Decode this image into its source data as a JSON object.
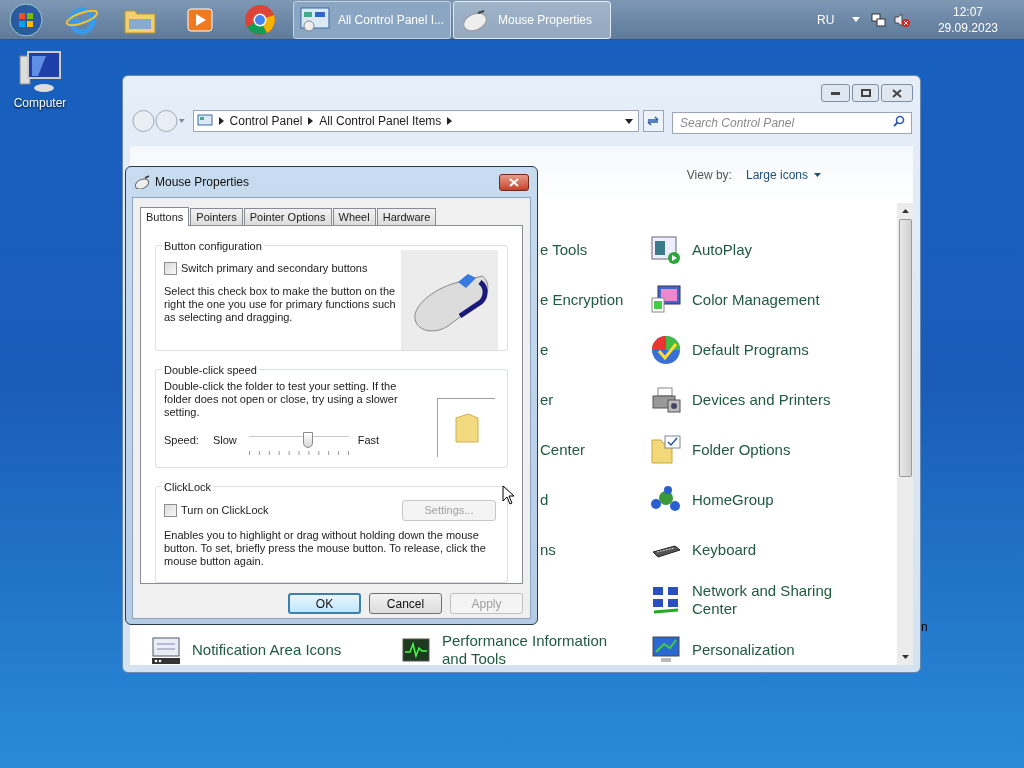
{
  "taskbar": {
    "tasks": [
      {
        "label": "All Control Panel I...",
        "selected": false
      },
      {
        "label": "Mouse Properties",
        "selected": true
      }
    ],
    "language": "RU",
    "time": "12:07",
    "date": "29.09.2023"
  },
  "desktop": {
    "icon_label": "Computer",
    "edge_text": "n"
  },
  "control_panel": {
    "breadcrumbs": [
      "Control Panel",
      "All Control Panel Items"
    ],
    "search": {
      "placeholder": "Search Control Panel"
    },
    "view_by_label": "View by:",
    "view_by_value": "Large icons",
    "rows": [
      {
        "middle": {
          "label": "e Tools",
          "kind": "fragment"
        },
        "right": {
          "label": "AutoPlay",
          "kind": "item"
        }
      },
      {
        "middle": {
          "label": "e Encryption",
          "kind": "fragment"
        },
        "right": {
          "label": "Color Management",
          "kind": "item"
        }
      },
      {
        "middle": {
          "label": "e",
          "kind": "fragment"
        },
        "right": {
          "label": "Default Programs",
          "kind": "item"
        }
      },
      {
        "middle": {
          "label": "er",
          "kind": "fragment"
        },
        "right": {
          "label": "Devices and Printers",
          "kind": "item"
        }
      },
      {
        "middle": {
          "label": "Center",
          "kind": "fragment"
        },
        "right": {
          "label": "Folder Options",
          "kind": "item"
        }
      },
      {
        "middle": {
          "label": "d",
          "kind": "fragment"
        },
        "right": {
          "label": "HomeGroup",
          "kind": "item"
        }
      },
      {
        "middle": {
          "label": "ns",
          "kind": "fragment"
        },
        "right": {
          "label": "Keyboard",
          "kind": "item"
        }
      },
      {
        "right": {
          "label": "Network and Sharing Center",
          "kind": "item"
        }
      },
      {
        "left": {
          "label": "Notification Area Icons",
          "kind": "item"
        },
        "middle": {
          "label": "Performance Information and Tools",
          "kind": "item"
        },
        "right": {
          "label": "Personalization",
          "kind": "item"
        }
      }
    ]
  },
  "dialog": {
    "title": "Mouse Properties",
    "tabs": [
      {
        "label": "Buttons",
        "selected": true
      },
      {
        "label": "Pointers",
        "selected": false
      },
      {
        "label": "Pointer Options",
        "selected": false
      },
      {
        "label": "Wheel",
        "selected": false
      },
      {
        "label": "Hardware",
        "selected": false
      }
    ],
    "button_configuration": {
      "title": "Button configuration",
      "checkbox": {
        "label": "Switch primary and secondary buttons",
        "checked": false
      },
      "description": "Select this check box to make the button on the right the one you use for primary functions such as selecting and dragging."
    },
    "double_click_speed": {
      "title": "Double-click speed",
      "description": "Double-click the folder to test your setting. If the folder does not open or close, try using a slower setting.",
      "speed_label": "Speed:",
      "slow_label": "Slow",
      "fast_label": "Fast",
      "level": 0.59
    },
    "clicklock": {
      "title": "ClickLock",
      "checkbox": {
        "label": "Turn on ClickLock",
        "checked": false
      },
      "settings_button": {
        "label": "Settings...",
        "disabled": true
      },
      "description": "Enables you to highlight or drag without holding down the mouse button. To set, briefly press the mouse button. To release, click the mouse button again."
    },
    "buttons": [
      {
        "label": "OK",
        "disabled": false,
        "default": true
      },
      {
        "label": "Cancel",
        "disabled": false,
        "default": false
      },
      {
        "label": "Apply",
        "disabled": true,
        "default": false
      }
    ]
  }
}
